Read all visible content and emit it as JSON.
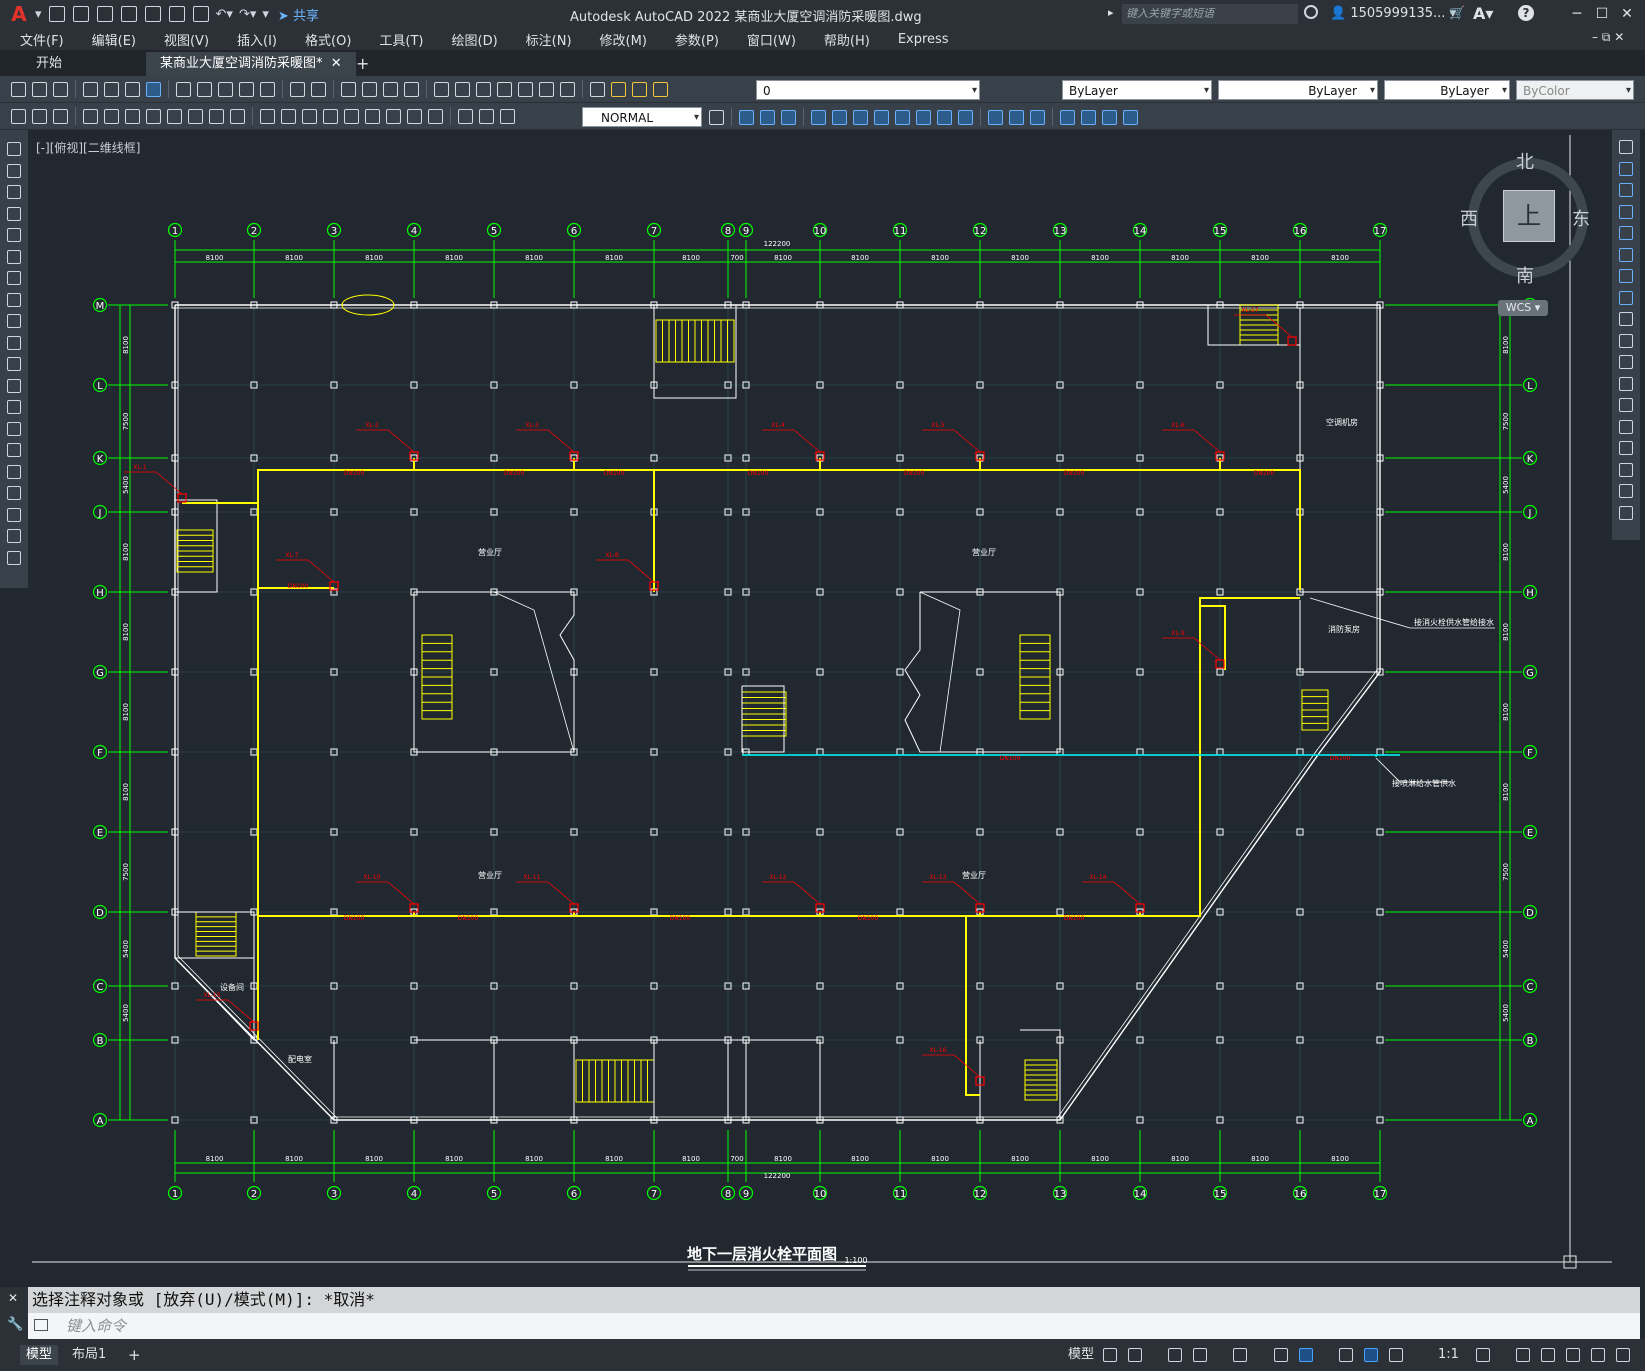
{
  "app": {
    "title": "Autodesk AutoCAD 2022    某商业大厦空调消防采暖图.dwg",
    "share_label": "共享",
    "search_placeholder": "键入关键字或短语",
    "user": "1505999135..."
  },
  "menu": [
    "文件(F)",
    "编辑(E)",
    "视图(V)",
    "插入(I)",
    "格式(O)",
    "工具(T)",
    "绘图(D)",
    "标注(N)",
    "修改(M)",
    "参数(P)",
    "窗口(W)",
    "帮助(H)",
    "Express"
  ],
  "tabs": [
    {
      "label": "开始"
    },
    {
      "label": "某商业大厦空调消防采暖图*"
    }
  ],
  "toolbar": {
    "layer_value": "0",
    "color_value": "ByLayer",
    "linetype_value": "ByLayer",
    "lineweight_value": "ByLayer",
    "plotstyle_value": "ByColor",
    "dimstyle_value": "NORMAL"
  },
  "viewport": {
    "label": "[-][俯视][二维线框]",
    "viewcube_top": "上",
    "viewcube_north": "北",
    "viewcube_south": "南",
    "viewcube_east": "东",
    "viewcube_west": "西",
    "wcs": "WCS"
  },
  "drawing": {
    "col_labels": [
      "1",
      "2",
      "3",
      "4",
      "5",
      "6",
      "7",
      "8",
      "9",
      "10",
      "11",
      "12",
      "13",
      "14",
      "15",
      "16",
      "17"
    ],
    "row_labels": [
      "M",
      "L",
      "K",
      "J",
      "H",
      "G",
      "F",
      "E",
      "D",
      "C",
      "B",
      "A"
    ],
    "top_dims": [
      "8100",
      "8100",
      "8100",
      "8100",
      "8100",
      "8100",
      "8100",
      "700",
      "8100",
      "8100",
      "8100",
      "8100",
      "8100",
      "8100",
      "8100",
      "8100"
    ],
    "total_dim": "122200",
    "right_dims": [
      "8100",
      "7500",
      "5400",
      "8100",
      "8100",
      "8100",
      "8100",
      "7500",
      "5400",
      "5400"
    ],
    "title": "地下一层消火栓平面图",
    "scale": "1:100",
    "notes": {
      "note1": "接消火栓供水管给接水",
      "note2": "接喷淋给水管供水"
    },
    "rooms": {
      "hall1": "营业厅",
      "hall2": "营业厅",
      "hall3": "营业厅",
      "hall4": "营业厅",
      "ac_room": "空调机房",
      "pump_room": "消防泵房",
      "equip_room": "设备间",
      "elec_room": "配电室"
    },
    "hydrants": [
      "XL-1",
      "XL-2",
      "XL-3",
      "XL-4",
      "XL-5",
      "XL-6",
      "XL-7",
      "XL-8",
      "XL-9",
      "XL-10",
      "XL-11",
      "XL-12",
      "XL-13",
      "XL-14",
      "XL-15",
      "XL-16",
      "XL-17"
    ],
    "pipe_label": "DN100",
    "colors": {
      "grid": "#00ff00",
      "wall": "#ffffff",
      "pipe": "#ffff00",
      "annot": "#ff0000",
      "cyan": "#00ffff"
    }
  },
  "command": {
    "history": "选择注释对象或 [放弃(U)/模式(M)]: *取消*",
    "input_placeholder": "键入命令"
  },
  "status": {
    "layout_tabs": [
      "模型",
      "布局1"
    ],
    "model_label": "模型",
    "scale_label": "1:1"
  }
}
